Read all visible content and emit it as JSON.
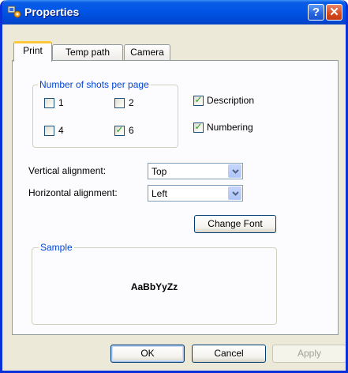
{
  "window": {
    "title": "Properties",
    "help_label": "?",
    "close_label": "✕"
  },
  "tabs": [
    {
      "label": "Print",
      "active": true
    },
    {
      "label": "Temp path",
      "active": false
    },
    {
      "label": "Camera",
      "active": false
    }
  ],
  "shots_group": {
    "legend": "Number of shots per page",
    "options": [
      {
        "label": "1",
        "checked": false
      },
      {
        "label": "2",
        "checked": false
      },
      {
        "label": "4",
        "checked": false
      },
      {
        "label": "6",
        "checked": true
      }
    ]
  },
  "description": {
    "label": "Description",
    "checked": true
  },
  "numbering": {
    "label": "Numbering",
    "checked": true
  },
  "vertical_alignment": {
    "label": "Vertical alignment:",
    "value": "Top"
  },
  "horizontal_alignment": {
    "label": "Horizontal alignment:",
    "value": "Left"
  },
  "change_font_label": "Change Font",
  "sample": {
    "legend": "Sample",
    "text": "AaBbYyZz"
  },
  "footer": {
    "ok_label": "OK",
    "cancel_label": "Cancel",
    "apply_label": "Apply"
  },
  "icons": {
    "app": "properties-app-icon",
    "dropdown": "chevron-down-icon",
    "check": "checkmark-icon"
  },
  "colors": {
    "title_bar": "#0055e5",
    "group_legend": "#0046d5",
    "check": "#21a121",
    "close": "#d9491e"
  }
}
